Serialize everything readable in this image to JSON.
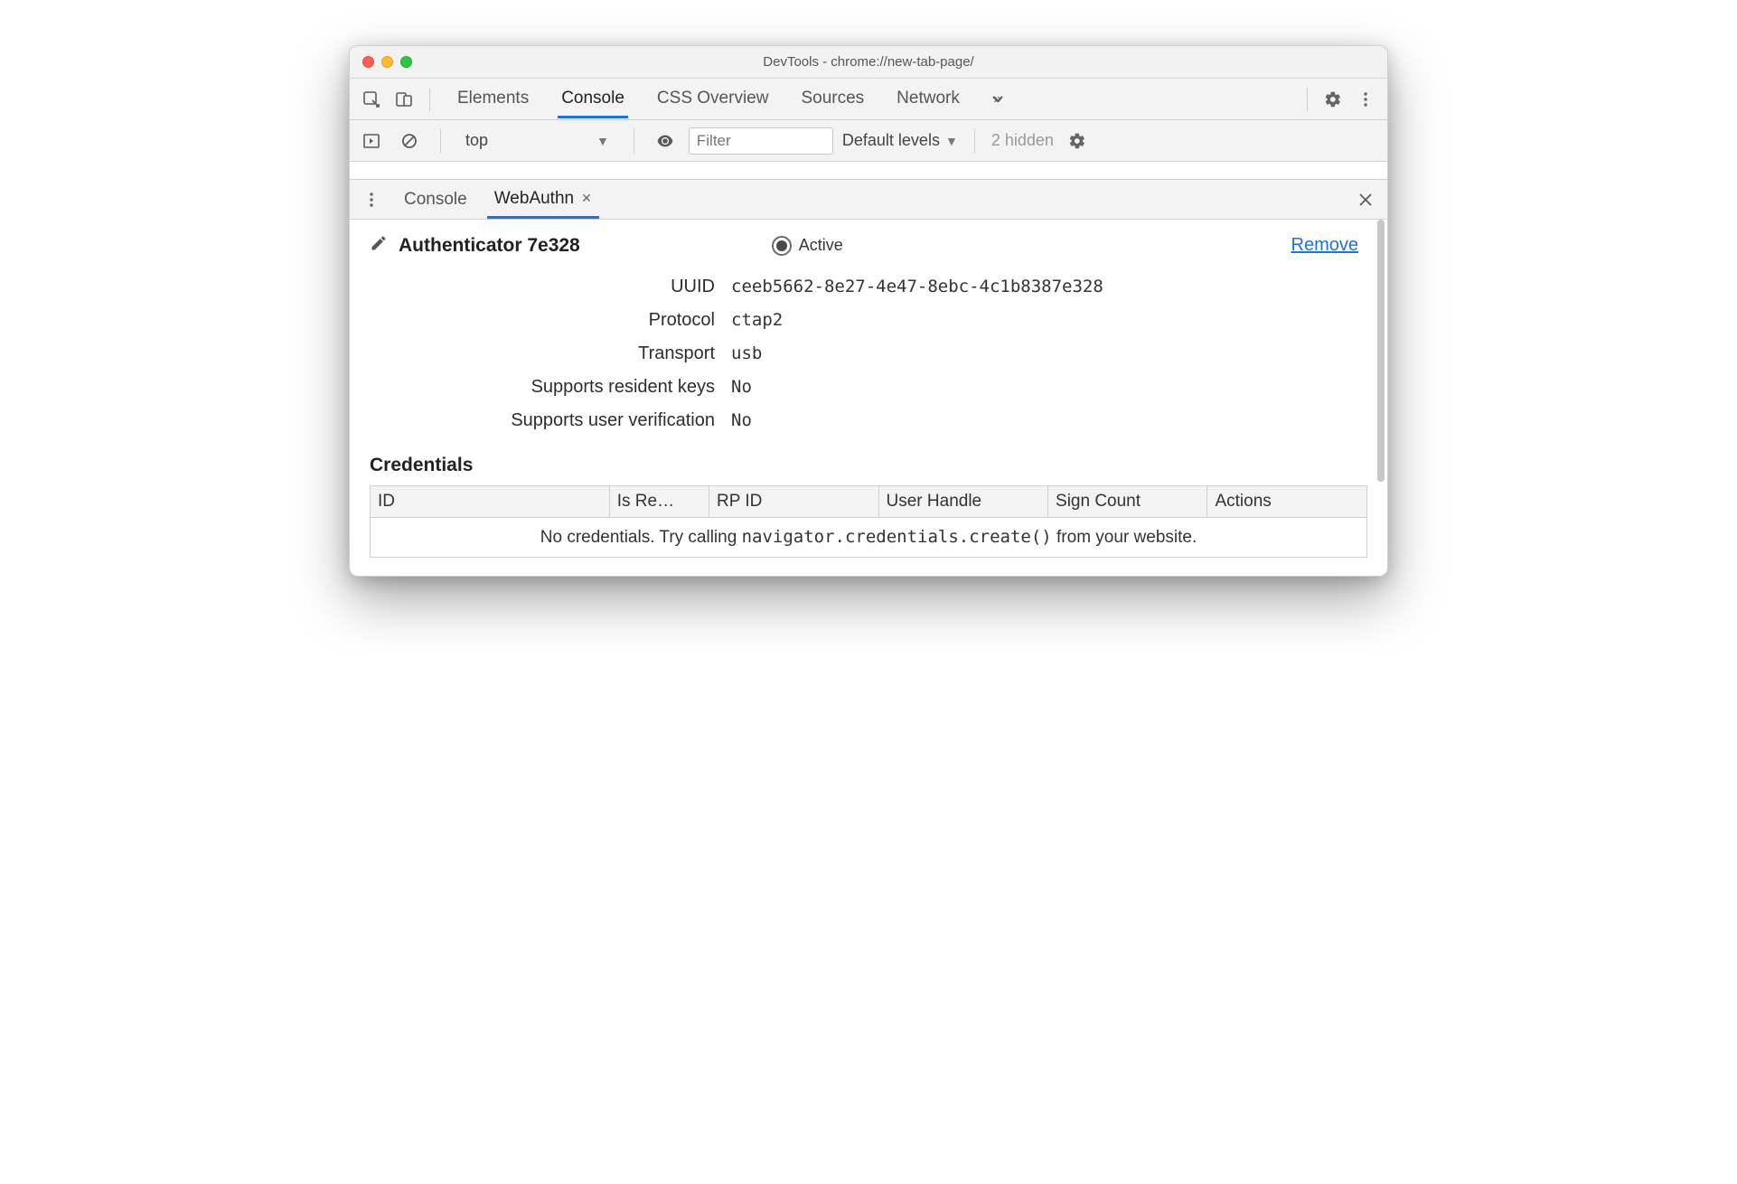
{
  "window": {
    "title": "DevTools - chrome://new-tab-page/"
  },
  "panel_tabs": {
    "items": [
      "Elements",
      "Console",
      "CSS Overview",
      "Sources",
      "Network"
    ],
    "active_index": 1
  },
  "console_toolbar": {
    "context": "top",
    "filter_placeholder": "Filter",
    "levels": "Default levels",
    "hidden": "2 hidden"
  },
  "drawer": {
    "tabs": [
      "Console",
      "WebAuthn"
    ],
    "active_index": 1
  },
  "authenticator": {
    "title": "Authenticator 7e328",
    "active_label": "Active",
    "remove_label": "Remove",
    "props": {
      "uuid_label": "UUID",
      "uuid": "ceeb5662-8e27-4e47-8ebc-4c1b8387e328",
      "protocol_label": "Protocol",
      "protocol": "ctap2",
      "transport_label": "Transport",
      "transport": "usb",
      "rk_label": "Supports resident keys",
      "rk": "No",
      "uv_label": "Supports user verification",
      "uv": "No"
    }
  },
  "credentials": {
    "heading": "Credentials",
    "columns": [
      "ID",
      "Is Re…",
      "RP ID",
      "User Handle",
      "Sign Count",
      "Actions"
    ],
    "empty_prefix": "No credentials. Try calling ",
    "empty_code": "navigator.credentials.create()",
    "empty_suffix": " from your website."
  }
}
